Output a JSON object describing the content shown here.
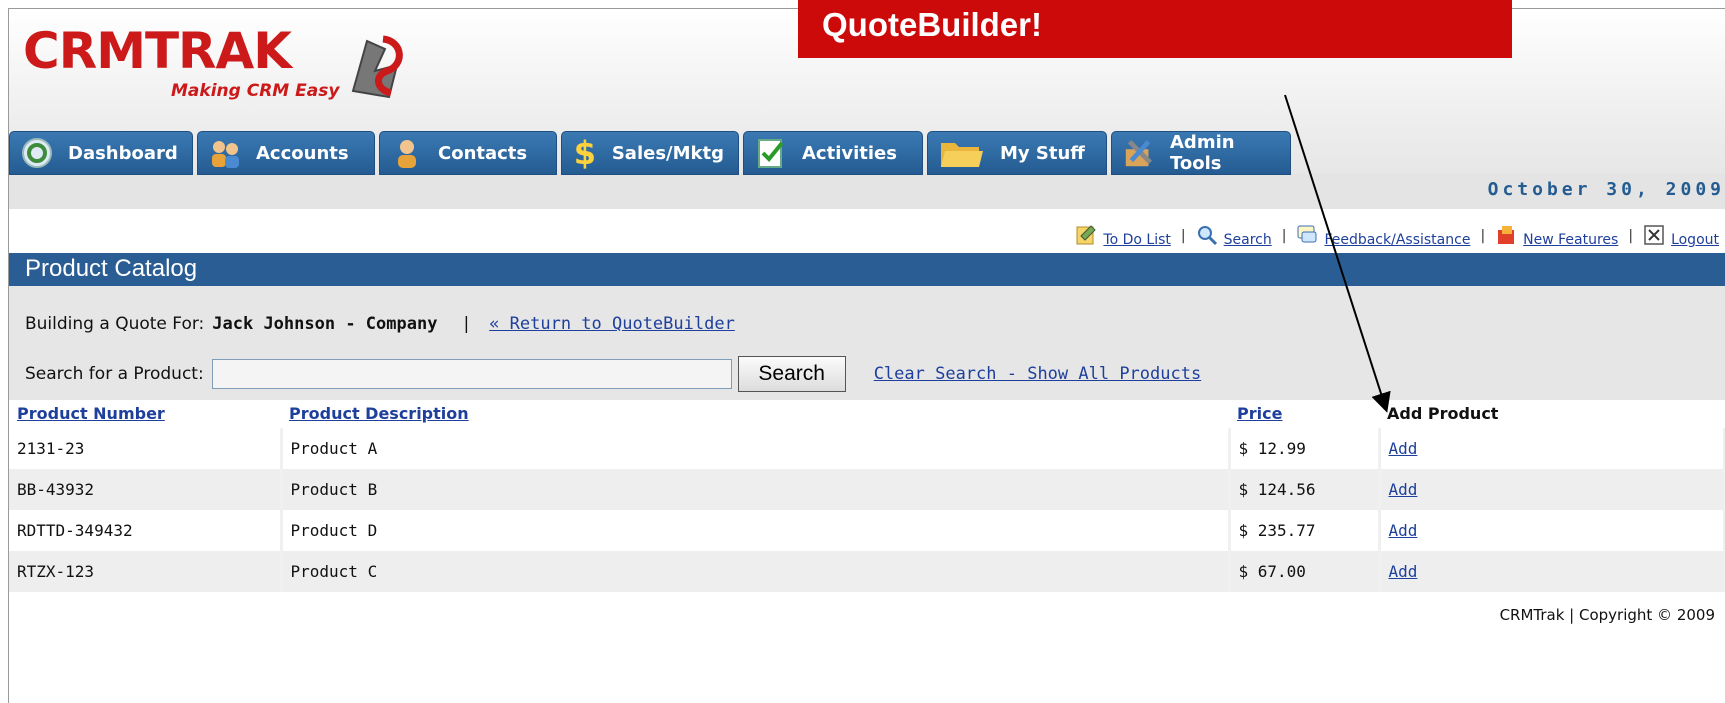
{
  "banner": {
    "text": "QuoteBuilder!"
  },
  "logo": {
    "name": "CRMTRAK",
    "tagline": "Making CRM Easy"
  },
  "tabs": [
    {
      "label": "Dashboard",
      "icon": "dashboard-icon"
    },
    {
      "label": "Accounts",
      "icon": "accounts-icon"
    },
    {
      "label": "Contacts",
      "icon": "contacts-icon"
    },
    {
      "label": "Sales/Mktg",
      "icon": "dollar-icon"
    },
    {
      "label": "Activities",
      "icon": "activities-icon"
    },
    {
      "label": "My Stuff",
      "icon": "folder-icon"
    },
    {
      "label": "Admin Tools",
      "icon": "tools-icon"
    }
  ],
  "date": "October 30, 2009",
  "utility_links": [
    {
      "label": "To Do List",
      "icon": "todo-icon"
    },
    {
      "label": "Search",
      "icon": "search-icon"
    },
    {
      "label": "Feedback/Assistance",
      "icon": "feedback-icon"
    },
    {
      "label": "New Features",
      "icon": "new-features-icon"
    },
    {
      "label": "Logout",
      "icon": "logout-icon"
    }
  ],
  "catalog": {
    "title": "Product Catalog"
  },
  "quote": {
    "prefix": "Building a Quote For:",
    "company": "Jack Johnson - Company",
    "separator": "|",
    "return_link": "« Return to QuoteBuilder"
  },
  "search": {
    "label": "Search for a Product:",
    "value": "",
    "button": "Search",
    "clear_link": "Clear Search - Show All Products"
  },
  "table": {
    "headers": [
      "Product Number",
      "Product Description",
      "Price",
      "Add Product"
    ],
    "rows": [
      {
        "number": "2131-23",
        "description": "Product A",
        "price": "$ 12.99",
        "action": "Add"
      },
      {
        "number": "BB-43932",
        "description": "Product B",
        "price": "$ 124.56",
        "action": "Add"
      },
      {
        "number": "RDTTD-349432",
        "description": "Product D",
        "price": "$ 235.77",
        "action": "Add"
      },
      {
        "number": "RTZX-123",
        "description": "Product C",
        "price": "$ 67.00",
        "action": "Add"
      }
    ]
  },
  "footer": "CRMTrak | Copyright © 2009",
  "colors": {
    "brand_red": "#cc1a1a",
    "banner_red": "#cc0a0a",
    "nav_blue": "#2a5d93",
    "link_blue": "#1e3f9c"
  }
}
